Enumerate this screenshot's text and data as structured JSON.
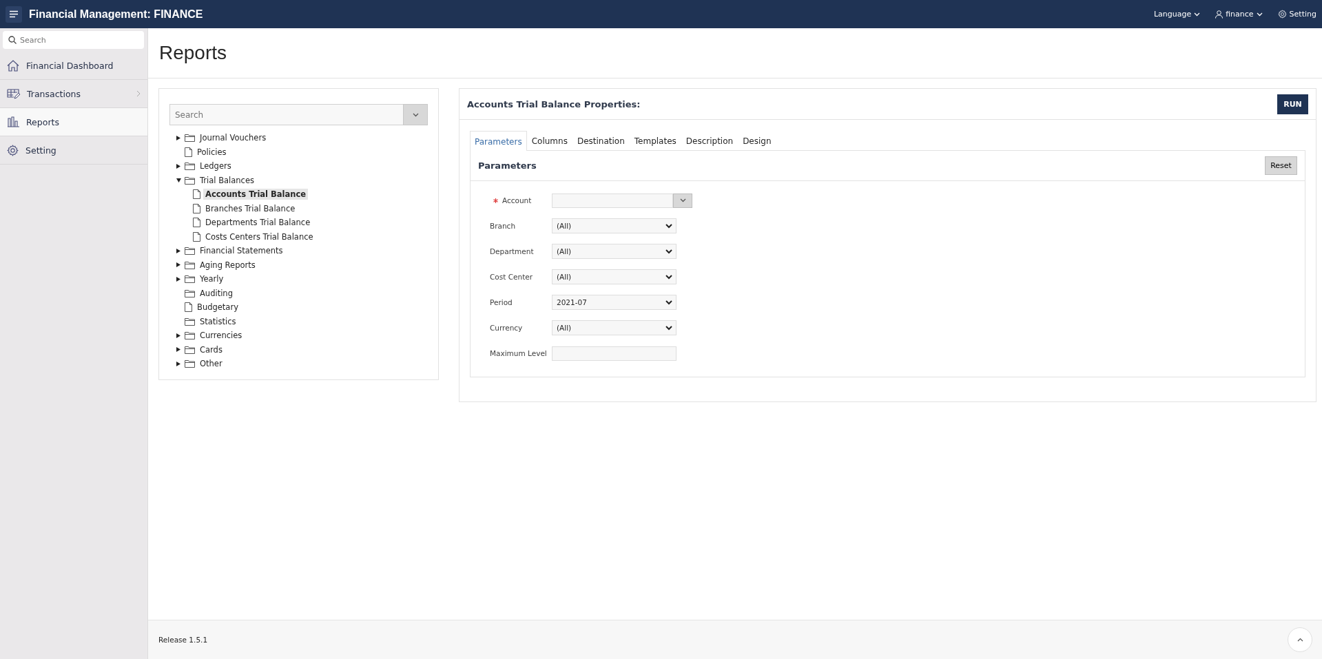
{
  "header": {
    "title": "Financial Management: FINANCE",
    "menus": [
      {
        "kind": "language",
        "label": "Language"
      },
      {
        "kind": "user",
        "label": "finance"
      },
      {
        "kind": "setting",
        "label": "Setting"
      }
    ]
  },
  "sidebar": {
    "search": {
      "placeholder": "Search"
    },
    "items": [
      {
        "label": "Financial Dashboard",
        "selected": false,
        "has_children": false
      },
      {
        "label": "Transactions",
        "selected": false,
        "has_children": true
      },
      {
        "label": "Reports",
        "selected": true,
        "has_children": false
      },
      {
        "label": "Setting",
        "selected": false,
        "has_children": false
      }
    ]
  },
  "page_title": "Reports",
  "tree": {
    "search": {
      "placeholder": "Search"
    },
    "nodes": [
      {
        "label": "Journal Vouchers",
        "kind": "folder",
        "expanded": false,
        "selected": false
      },
      {
        "label": "Policies",
        "kind": "file",
        "selected": false
      },
      {
        "label": "Ledgers",
        "kind": "folder",
        "expanded": false,
        "selected": false
      },
      {
        "label": "Trial Balances",
        "kind": "folder",
        "expanded": true,
        "selected": false,
        "children": [
          {
            "label": "Accounts Trial Balance",
            "kind": "file",
            "selected": true
          },
          {
            "label": "Branches Trial Balance",
            "kind": "file",
            "selected": false
          },
          {
            "label": "Departments Trial Balance",
            "kind": "file",
            "selected": false
          },
          {
            "label": "Costs Centers Trial Balance",
            "kind": "file",
            "selected": false
          }
        ]
      },
      {
        "label": "Financial Statements",
        "kind": "folder",
        "expanded": false,
        "selected": false
      },
      {
        "label": "Aging Reports",
        "kind": "folder",
        "expanded": false,
        "selected": false
      },
      {
        "label": "Yearly",
        "kind": "folder",
        "expanded": false,
        "selected": false
      },
      {
        "label": "Auditing",
        "kind": "folder",
        "selected": false
      },
      {
        "label": "Budgetary",
        "kind": "file",
        "selected": false
      },
      {
        "label": "Statistics",
        "kind": "folder",
        "selected": false
      },
      {
        "label": "Currencies",
        "kind": "folder",
        "expanded": false,
        "selected": false
      },
      {
        "label": "Cards",
        "kind": "folder",
        "expanded": false,
        "selected": false
      },
      {
        "label": "Other",
        "kind": "folder",
        "expanded": false,
        "selected": false
      }
    ]
  },
  "properties": {
    "title": "Accounts Trial Balance Properties:",
    "run_button": "RUN",
    "tabs": [
      {
        "label": "Parameters",
        "selected": true
      },
      {
        "label": "Columns",
        "selected": false
      },
      {
        "label": "Destination",
        "selected": false
      },
      {
        "label": "Templates",
        "selected": false
      },
      {
        "label": "Description",
        "selected": false
      },
      {
        "label": "Design",
        "selected": false
      }
    ],
    "section": {
      "title": "Parameters",
      "reset_button": "Reset",
      "fields": [
        {
          "label": "Account",
          "kind": "popup",
          "required": true
        },
        {
          "label": "Branch",
          "kind": "select",
          "required": false,
          "value": "(All)"
        },
        {
          "label": "Department",
          "kind": "select",
          "required": false,
          "value": "(All)"
        },
        {
          "label": "Cost Center",
          "kind": "select",
          "required": false,
          "value": "(All)"
        },
        {
          "label": "Period",
          "kind": "select",
          "required": false,
          "value": "2021-07"
        },
        {
          "label": "Currency",
          "kind": "select",
          "required": false,
          "value": "(All)"
        },
        {
          "label": "Maximum Level",
          "kind": "text",
          "required": false
        }
      ]
    }
  },
  "footer": {
    "release": "Release 1.5.1"
  }
}
